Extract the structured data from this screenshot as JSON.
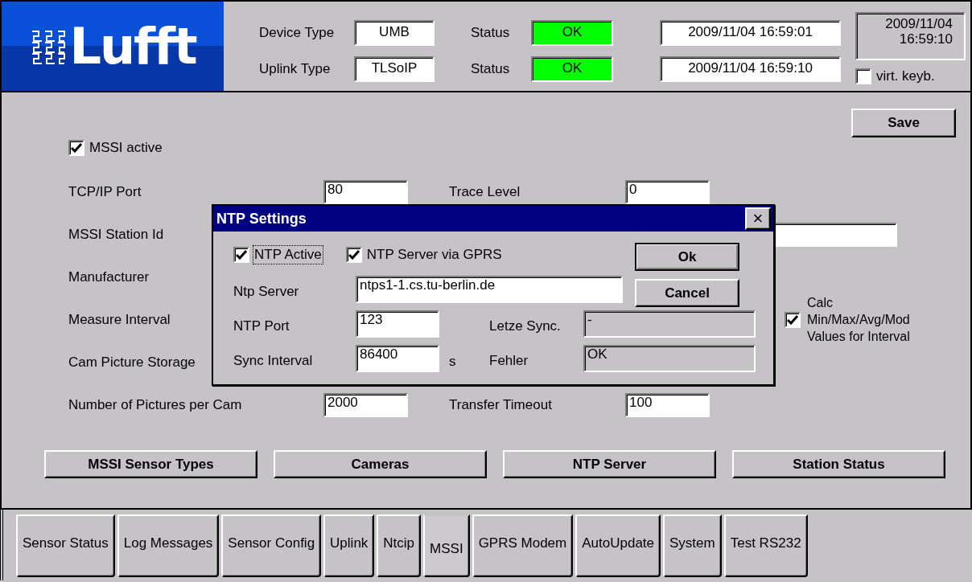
{
  "logo": {
    "text": "Lufft"
  },
  "header": {
    "rows": [
      {
        "label": "Device Type",
        "value": "UMB",
        "status_label": "Status",
        "status": "OK",
        "color": "#00ff00",
        "timestamp": "2009/11/04 16:59:01"
      },
      {
        "label": "Uplink Type",
        "value": "TLSoIP",
        "status_label": "Status",
        "status": "OK",
        "color": "#00ff00",
        "timestamp": "2009/11/04 16:59:10"
      }
    ],
    "clock": "2009/11/04 16:59:10",
    "virtual_keyboard": {
      "label": "virt. keyb.",
      "checked": false
    }
  },
  "main": {
    "save_button": "Save",
    "mssi_active": {
      "label": "MSSI active",
      "checked": true
    },
    "rows": [
      {
        "kind": "pair",
        "label": "TCP/IP Port",
        "value": "80",
        "label_2": "Trace Level",
        "value_2": "0"
      },
      {
        "kind": "wide",
        "label": "MSSI Station Id"
      },
      {
        "kind": "label",
        "label": "Manufacturer"
      },
      {
        "kind": "label",
        "label": "Measure Interval"
      },
      {
        "kind": "label",
        "label": "Cam Picture Storage"
      },
      {
        "kind": "pair",
        "label": "Number of Pictures per Cam",
        "value": "2000",
        "label_2": "Transfer Timeout",
        "value_2": "100"
      }
    ],
    "calc_values": {
      "label": "Calc Min/Max/Avg/Mod Values for Interval",
      "checked": true
    },
    "buttons": [
      "MSSI Sensor Types",
      "Cameras",
      "NTP Server",
      "Station Status"
    ]
  },
  "dialog": {
    "title": "NTP Settings",
    "close": "×",
    "checkboxes": [
      {
        "label": "NTP Active",
        "checked": true,
        "focused": true
      },
      {
        "label": "NTP Server via GPRS",
        "checked": true,
        "focused": false
      }
    ],
    "buttons": [
      {
        "label": "Ok",
        "default": true
      },
      {
        "label": "Cancel",
        "default": false
      }
    ],
    "server": {
      "label": "Ntp Server",
      "value": "ntps1-1.cs.tu-berlin.de"
    },
    "port": {
      "label": "NTP Port",
      "value": "123"
    },
    "sync_interval": {
      "label": "Sync Interval",
      "value": "86400",
      "unit": "s"
    },
    "last_sync": {
      "label": "Letze Sync.",
      "value": "-"
    },
    "error": {
      "label": "Fehler",
      "value": "OK"
    }
  },
  "tabs": [
    {
      "label": "Sensor Status",
      "selected": false
    },
    {
      "label": "Log Messages",
      "selected": false
    },
    {
      "label": "Sensor Config",
      "selected": false
    },
    {
      "label": "Uplink",
      "selected": false
    },
    {
      "label": "Ntcip",
      "selected": false
    },
    {
      "label": "MSSI",
      "selected": true
    },
    {
      "label": "GPRS Modem",
      "selected": false
    },
    {
      "label": "AutoUpdate",
      "selected": false
    },
    {
      "label": "System",
      "selected": false
    },
    {
      "label": "Test RS232",
      "selected": false
    }
  ]
}
